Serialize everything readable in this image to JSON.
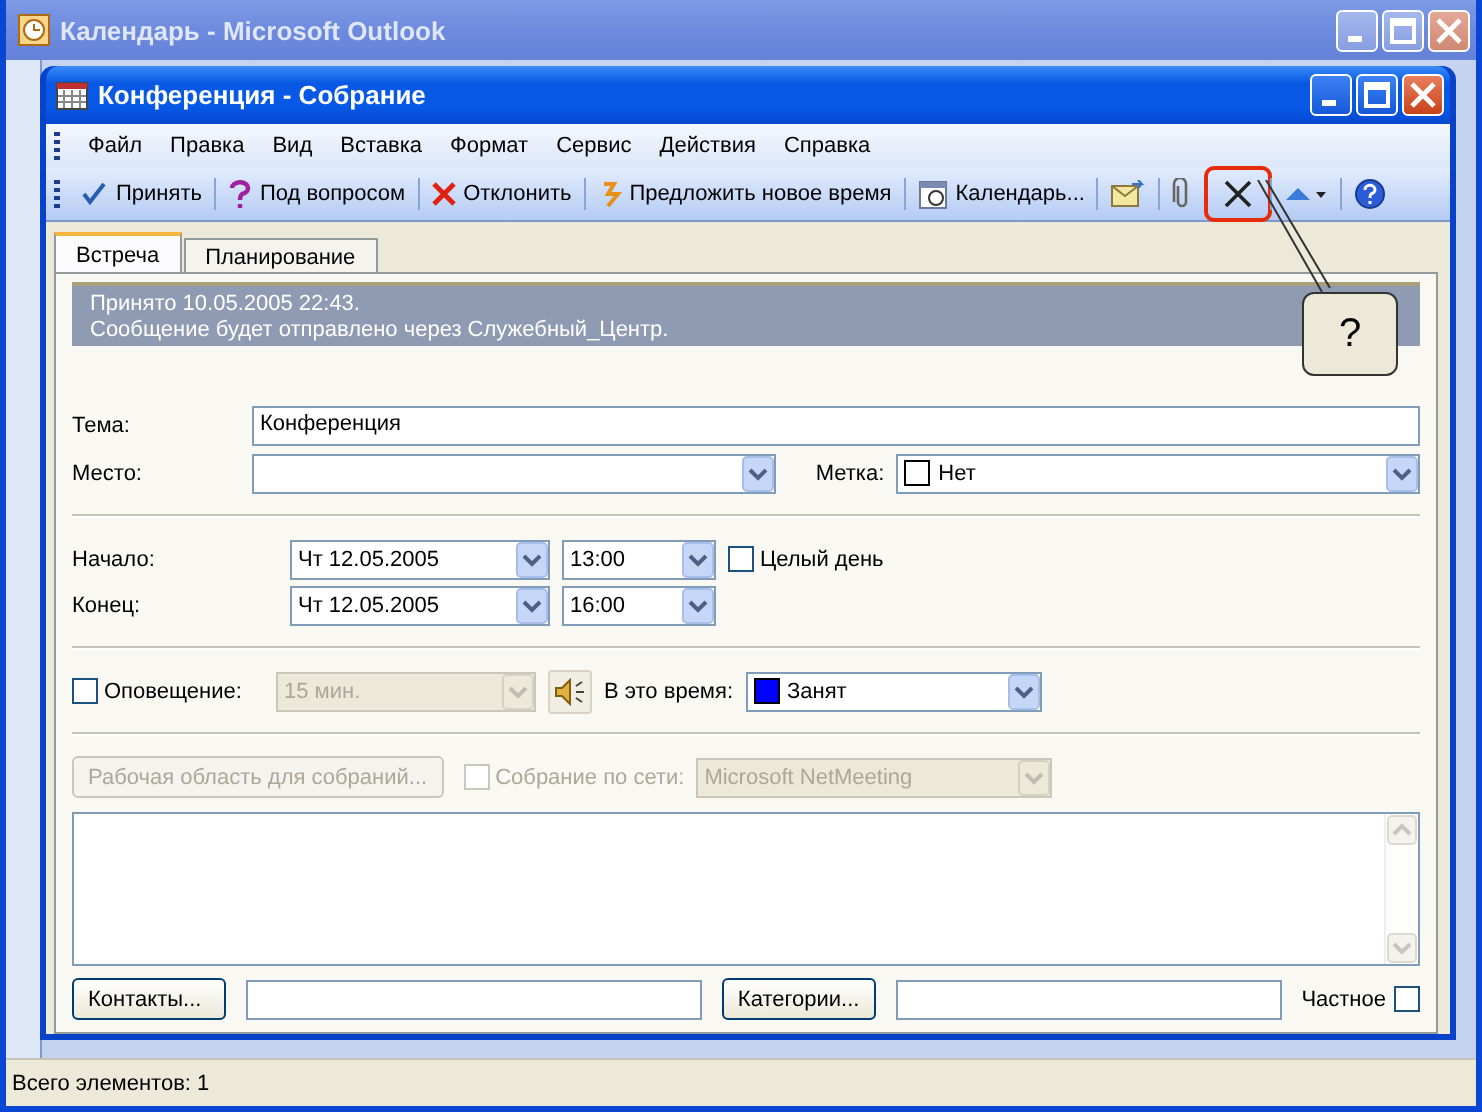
{
  "outer_window": {
    "title": "Календарь - Microsoft Outlook"
  },
  "dialog": {
    "title": "Конференция - Собрание"
  },
  "menu": [
    "Файл",
    "Правка",
    "Вид",
    "Вставка",
    "Формат",
    "Сервис",
    "Действия",
    "Справка"
  ],
  "toolbar": [
    {
      "kind": "text",
      "label": "Принять",
      "highlighted": false
    },
    {
      "kind": "text",
      "label": "Под вопросом",
      "highlighted": false
    },
    {
      "kind": "text",
      "label": "Отклонить",
      "highlighted": false
    },
    {
      "kind": "text",
      "label": "Предложить новое время",
      "highlighted": false
    },
    {
      "kind": "text",
      "label": "Календарь...",
      "highlighted": false
    },
    {
      "kind": "icon",
      "highlighted": false
    },
    {
      "kind": "icon",
      "highlighted": false
    },
    {
      "kind": "icon",
      "highlighted": true
    },
    {
      "kind": "icon",
      "highlighted": false
    },
    {
      "kind": "icon",
      "highlighted": false
    }
  ],
  "tabs": [
    {
      "label": "Встреча",
      "selected": true
    },
    {
      "label": "Планирование",
      "selected": false
    }
  ],
  "info": [
    "Принято 10.05.2005 22:43.",
    "Сообщение будет отправлено через Служебный_Центр."
  ],
  "callout": {
    "text": "?"
  },
  "subject": {
    "label": "Тема:",
    "value": "Конференция"
  },
  "location": {
    "label": "Место:"
  },
  "tag": {
    "label": "Метка:",
    "value": "Нет",
    "color": "#ffffff"
  },
  "start": {
    "label": "Начало:",
    "date": "Чт 12.05.2005",
    "time": "13:00"
  },
  "end": {
    "label": "Конец:",
    "date": "Чт 12.05.2005",
    "time": "16:00"
  },
  "all_day": {
    "label": "Целый день",
    "checked": false
  },
  "reminder": {
    "label": "Оповещение:",
    "checked": false,
    "value": "15 мин.",
    "disabled": true
  },
  "show_as": {
    "label": "В это время:",
    "value": "Занят",
    "color": "#0000ff"
  },
  "workspace": {
    "label": "Рабочая область для собраний...",
    "disabled": true
  },
  "online": {
    "label": "Собрание по сети:",
    "checked": false,
    "disabled": true,
    "value": "Microsoft NetMeeting"
  },
  "contacts": {
    "label": "Контакты..."
  },
  "categories": {
    "label": "Категории..."
  },
  "private": {
    "label": "Частное",
    "checked": false
  },
  "status_bar": {
    "text": "Всего элементов: 1"
  }
}
